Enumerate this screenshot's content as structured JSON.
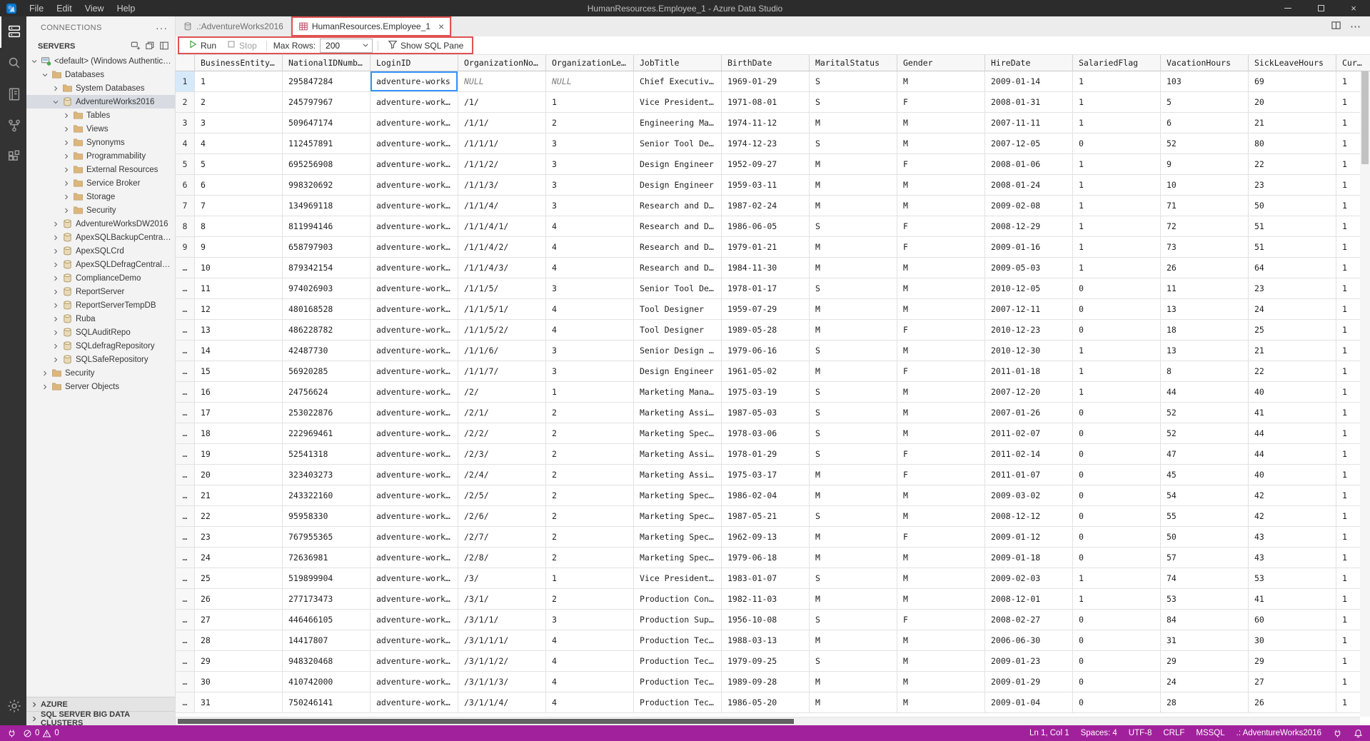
{
  "title_bar": {
    "menus": [
      "File",
      "Edit",
      "View",
      "Help"
    ],
    "title": "HumanResources.Employee_1 - Azure Data Studio"
  },
  "activity_bar": {
    "icons": [
      "connections",
      "search",
      "notebooks",
      "source-control",
      "extensions"
    ],
    "bottom_icons": [
      "settings"
    ]
  },
  "sidebar": {
    "title": "CONNECTIONS",
    "section": {
      "label": "SERVERS",
      "actions": [
        "new-connection",
        "new-server-group",
        "show-connections-pane"
      ]
    },
    "tree": [
      {
        "label": "<default> (Windows Authenticati…",
        "level": 0,
        "icon": "server",
        "chevron": "expanded"
      },
      {
        "label": "Databases",
        "level": 1,
        "icon": "folder",
        "chevron": "expanded"
      },
      {
        "label": "System Databases",
        "level": 2,
        "icon": "folder",
        "chevron": "collapsed"
      },
      {
        "label": "AdventureWorks2016",
        "level": 2,
        "icon": "database",
        "chevron": "expanded",
        "selected": true
      },
      {
        "label": "Tables",
        "level": 3,
        "icon": "folder",
        "chevron": "collapsed"
      },
      {
        "label": "Views",
        "level": 3,
        "icon": "folder",
        "chevron": "collapsed"
      },
      {
        "label": "Synonyms",
        "level": 3,
        "icon": "folder",
        "chevron": "collapsed"
      },
      {
        "label": "Programmability",
        "level": 3,
        "icon": "folder",
        "chevron": "collapsed"
      },
      {
        "label": "External Resources",
        "level": 3,
        "icon": "folder",
        "chevron": "collapsed"
      },
      {
        "label": "Service Broker",
        "level": 3,
        "icon": "folder",
        "chevron": "collapsed"
      },
      {
        "label": "Storage",
        "level": 3,
        "icon": "folder",
        "chevron": "collapsed"
      },
      {
        "label": "Security",
        "level": 3,
        "icon": "folder",
        "chevron": "collapsed"
      },
      {
        "label": "AdventureWorksDW2016",
        "level": 2,
        "icon": "database",
        "chevron": "collapsed"
      },
      {
        "label": "ApexSQLBackupCentralRepository",
        "level": 2,
        "icon": "database",
        "chevron": "collapsed"
      },
      {
        "label": "ApexSQLCrd",
        "level": 2,
        "icon": "database",
        "chevron": "collapsed"
      },
      {
        "label": "ApexSQLDefragCentralRepository",
        "level": 2,
        "icon": "database",
        "chevron": "collapsed"
      },
      {
        "label": "ComplianceDemo",
        "level": 2,
        "icon": "database",
        "chevron": "collapsed"
      },
      {
        "label": "ReportServer",
        "level": 2,
        "icon": "database",
        "chevron": "collapsed"
      },
      {
        "label": "ReportServerTempDB",
        "level": 2,
        "icon": "database",
        "chevron": "collapsed"
      },
      {
        "label": "Ruba",
        "level": 2,
        "icon": "database",
        "chevron": "collapsed"
      },
      {
        "label": "SQLAuditRepo",
        "level": 2,
        "icon": "database",
        "chevron": "collapsed"
      },
      {
        "label": "SQLdefragRepository",
        "level": 2,
        "icon": "database",
        "chevron": "collapsed"
      },
      {
        "label": "SQLSafeRepository",
        "level": 2,
        "icon": "database",
        "chevron": "collapsed"
      },
      {
        "label": "Security",
        "level": 1,
        "icon": "folder",
        "chevron": "collapsed"
      },
      {
        "label": "Server Objects",
        "level": 1,
        "icon": "folder",
        "chevron": "collapsed"
      }
    ],
    "collapsed_sections": [
      {
        "label": "AZURE"
      },
      {
        "label": "SQL SERVER BIG DATA CLUSTERS"
      }
    ]
  },
  "tabs": [
    {
      "label": ".:AdventureWorks2016",
      "icon": "database-file",
      "active": false
    },
    {
      "label": "HumanResources.Employee_1",
      "icon": "table",
      "active": true,
      "close": "×"
    }
  ],
  "toolbar": {
    "run_label": "Run",
    "stop_label": "Stop",
    "max_rows_label": "Max Rows:",
    "max_rows_value": "200",
    "show_sql_pane_label": "Show SQL Pane"
  },
  "grid": {
    "columns": [
      "",
      "BusinessEntity…",
      "NationalIDNumb…",
      "LoginID",
      "OrganizationNo…",
      "OrganizationLe…",
      "JobTitle",
      "BirthDate",
      "MaritalStatus",
      "Gender",
      "HireDate",
      "SalariedFlag",
      "VacationHours",
      "SickLeaveHours",
      "Cur…"
    ],
    "selected": {
      "row": 0,
      "col": 3
    },
    "rows": [
      [
        "1",
        "1",
        "295847284",
        "adventure-works",
        "NULL",
        "NULL",
        "Chief Executiv…",
        "1969-01-29",
        "S",
        "M",
        "2009-01-14",
        "1",
        "103",
        "69",
        "1"
      ],
      [
        "2",
        "2",
        "245797967",
        "adventure-work…",
        "/1/",
        "1",
        "Vice President…",
        "1971-08-01",
        "S",
        "F",
        "2008-01-31",
        "1",
        "5",
        "20",
        "1"
      ],
      [
        "3",
        "3",
        "509647174",
        "adventure-work…",
        "/1/1/",
        "2",
        "Engineering Ma…",
        "1974-11-12",
        "M",
        "M",
        "2007-11-11",
        "1",
        "6",
        "21",
        "1"
      ],
      [
        "4",
        "4",
        "112457891",
        "adventure-work…",
        "/1/1/1/",
        "3",
        "Senior Tool De…",
        "1974-12-23",
        "S",
        "M",
        "2007-12-05",
        "0",
        "52",
        "80",
        "1"
      ],
      [
        "5",
        "5",
        "695256908",
        "adventure-work…",
        "/1/1/2/",
        "3",
        "Design Engineer",
        "1952-09-27",
        "M",
        "F",
        "2008-01-06",
        "1",
        "9",
        "22",
        "1"
      ],
      [
        "6",
        "6",
        "998320692",
        "adventure-work…",
        "/1/1/3/",
        "3",
        "Design Engineer",
        "1959-03-11",
        "M",
        "M",
        "2008-01-24",
        "1",
        "10",
        "23",
        "1"
      ],
      [
        "7",
        "7",
        "134969118",
        "adventure-work…",
        "/1/1/4/",
        "3",
        "Research and D…",
        "1987-02-24",
        "M",
        "M",
        "2009-02-08",
        "1",
        "71",
        "50",
        "1"
      ],
      [
        "8",
        "8",
        "811994146",
        "adventure-work…",
        "/1/1/4/1/",
        "4",
        "Research and D…",
        "1986-06-05",
        "S",
        "F",
        "2008-12-29",
        "1",
        "72",
        "51",
        "1"
      ],
      [
        "9",
        "9",
        "658797903",
        "adventure-work…",
        "/1/1/4/2/",
        "4",
        "Research and D…",
        "1979-01-21",
        "M",
        "F",
        "2009-01-16",
        "1",
        "73",
        "51",
        "1"
      ],
      [
        "…",
        "10",
        "879342154",
        "adventure-work…",
        "/1/1/4/3/",
        "4",
        "Research and D…",
        "1984-11-30",
        "M",
        "M",
        "2009-05-03",
        "1",
        "26",
        "64",
        "1"
      ],
      [
        "…",
        "11",
        "974026903",
        "adventure-work…",
        "/1/1/5/",
        "3",
        "Senior Tool De…",
        "1978-01-17",
        "S",
        "M",
        "2010-12-05",
        "0",
        "11",
        "23",
        "1"
      ],
      [
        "…",
        "12",
        "480168528",
        "adventure-work…",
        "/1/1/5/1/",
        "4",
        "Tool Designer",
        "1959-07-29",
        "M",
        "M",
        "2007-12-11",
        "0",
        "13",
        "24",
        "1"
      ],
      [
        "…",
        "13",
        "486228782",
        "adventure-work…",
        "/1/1/5/2/",
        "4",
        "Tool Designer",
        "1989-05-28",
        "M",
        "F",
        "2010-12-23",
        "0",
        "18",
        "25",
        "1"
      ],
      [
        "…",
        "14",
        "42487730",
        "adventure-work…",
        "/1/1/6/",
        "3",
        "Senior Design …",
        "1979-06-16",
        "S",
        "M",
        "2010-12-30",
        "1",
        "13",
        "21",
        "1"
      ],
      [
        "…",
        "15",
        "56920285",
        "adventure-work…",
        "/1/1/7/",
        "3",
        "Design Engineer",
        "1961-05-02",
        "M",
        "F",
        "2011-01-18",
        "1",
        "8",
        "22",
        "1"
      ],
      [
        "…",
        "16",
        "24756624",
        "adventure-work…",
        "/2/",
        "1",
        "Marketing Mana…",
        "1975-03-19",
        "S",
        "M",
        "2007-12-20",
        "1",
        "44",
        "40",
        "1"
      ],
      [
        "…",
        "17",
        "253022876",
        "adventure-work…",
        "/2/1/",
        "2",
        "Marketing Assi…",
        "1987-05-03",
        "S",
        "M",
        "2007-01-26",
        "0",
        "52",
        "41",
        "1"
      ],
      [
        "…",
        "18",
        "222969461",
        "adventure-work…",
        "/2/2/",
        "2",
        "Marketing Spec…",
        "1978-03-06",
        "S",
        "M",
        "2011-02-07",
        "0",
        "52",
        "44",
        "1"
      ],
      [
        "…",
        "19",
        "52541318",
        "adventure-work…",
        "/2/3/",
        "2",
        "Marketing Assi…",
        "1978-01-29",
        "S",
        "F",
        "2011-02-14",
        "0",
        "47",
        "44",
        "1"
      ],
      [
        "…",
        "20",
        "323403273",
        "adventure-work…",
        "/2/4/",
        "2",
        "Marketing Assi…",
        "1975-03-17",
        "M",
        "F",
        "2011-01-07",
        "0",
        "45",
        "40",
        "1"
      ],
      [
        "…",
        "21",
        "243322160",
        "adventure-work…",
        "/2/5/",
        "2",
        "Marketing Spec…",
        "1986-02-04",
        "M",
        "M",
        "2009-03-02",
        "0",
        "54",
        "42",
        "1"
      ],
      [
        "…",
        "22",
        "95958330",
        "adventure-work…",
        "/2/6/",
        "2",
        "Marketing Spec…",
        "1987-05-21",
        "S",
        "M",
        "2008-12-12",
        "0",
        "55",
        "42",
        "1"
      ],
      [
        "…",
        "23",
        "767955365",
        "adventure-work…",
        "/2/7/",
        "2",
        "Marketing Spec…",
        "1962-09-13",
        "M",
        "F",
        "2009-01-12",
        "0",
        "50",
        "43",
        "1"
      ],
      [
        "…",
        "24",
        "72636981",
        "adventure-work…",
        "/2/8/",
        "2",
        "Marketing Spec…",
        "1979-06-18",
        "M",
        "M",
        "2009-01-18",
        "0",
        "57",
        "43",
        "1"
      ],
      [
        "…",
        "25",
        "519899904",
        "adventure-work…",
        "/3/",
        "1",
        "Vice President…",
        "1983-01-07",
        "S",
        "M",
        "2009-02-03",
        "1",
        "74",
        "53",
        "1"
      ],
      [
        "…",
        "26",
        "277173473",
        "adventure-work…",
        "/3/1/",
        "2",
        "Production Con…",
        "1982-11-03",
        "M",
        "M",
        "2008-12-01",
        "1",
        "53",
        "41",
        "1"
      ],
      [
        "…",
        "27",
        "446466105",
        "adventure-work…",
        "/3/1/1/",
        "3",
        "Production Sup…",
        "1956-10-08",
        "S",
        "F",
        "2008-02-27",
        "0",
        "84",
        "60",
        "1"
      ],
      [
        "…",
        "28",
        "14417807",
        "adventure-work…",
        "/3/1/1/1/",
        "4",
        "Production Tec…",
        "1988-03-13",
        "M",
        "M",
        "2006-06-30",
        "0",
        "31",
        "30",
        "1"
      ],
      [
        "…",
        "29",
        "948320468",
        "adventure-work…",
        "/3/1/1/2/",
        "4",
        "Production Tec…",
        "1979-09-25",
        "S",
        "M",
        "2009-01-23",
        "0",
        "29",
        "29",
        "1"
      ],
      [
        "…",
        "30",
        "410742000",
        "adventure-work…",
        "/3/1/1/3/",
        "4",
        "Production Tec…",
        "1989-09-28",
        "M",
        "M",
        "2009-01-29",
        "0",
        "24",
        "27",
        "1"
      ],
      [
        "…",
        "31",
        "750246141",
        "adventure-work…",
        "/3/1/1/4/",
        "4",
        "Production Tec…",
        "1986-05-20",
        "M",
        "M",
        "2009-01-04",
        "0",
        "28",
        "26",
        "1"
      ]
    ]
  },
  "status_bar": {
    "problems": {
      "errors": "0",
      "warnings": "0"
    },
    "right": [
      "Ln 1, Col 1",
      "Spaces: 4",
      "UTF-8",
      "CRLF",
      "MSSQL",
      ".: AdventureWorks2016"
    ]
  },
  "colors": {
    "status_bar": "#a1219c",
    "accent": "#3794ff",
    "annotation": "#e05252",
    "folder": "#dcb67a"
  }
}
